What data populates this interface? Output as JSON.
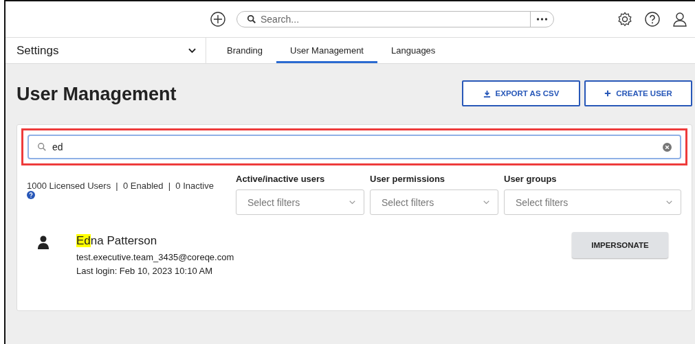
{
  "header": {
    "search_placeholder": "Search..."
  },
  "nav": {
    "section": "Settings",
    "tabs": [
      {
        "label": "Branding",
        "selected": false
      },
      {
        "label": "User Management",
        "selected": true
      },
      {
        "label": "Languages",
        "selected": false
      }
    ]
  },
  "page": {
    "title": "User Management",
    "buttons": [
      {
        "label": "EXPORT AS CSV",
        "kind": "export"
      },
      {
        "label": "CREATE USER",
        "kind": "create"
      }
    ]
  },
  "search": {
    "value": "ed",
    "outlined": true
  },
  "summary": "1000 Licensed Users  |  0 Enabled  |  0 Inactive",
  "filters": [
    {
      "label": "Active/inactive users",
      "placeholder": "Select filters"
    },
    {
      "label": "User permissions",
      "placeholder": "Select filters"
    },
    {
      "label": "User groups",
      "placeholder": "Select filters"
    }
  ],
  "users": [
    {
      "name_match": "Ed",
      "name_rest": "na Patterson",
      "email": "test.executive.team_3435@coreqe.com",
      "last_login": "Last login: Feb 10, 2023 10:10 AM",
      "action": "IMPERSONATE"
    }
  ]
}
